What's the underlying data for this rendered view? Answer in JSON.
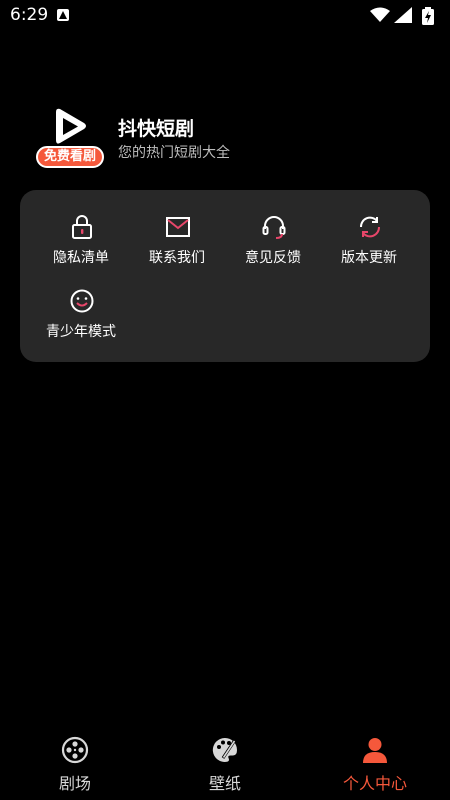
{
  "status_bar": {
    "time": "6:29",
    "icons": [
      "notification-a-icon",
      "wifi-icon",
      "signal-icon",
      "battery-charging-icon"
    ]
  },
  "header": {
    "logo_badge": "免费看剧",
    "title": "抖快短剧",
    "subtitle": "您的热门短剧大全"
  },
  "menu": {
    "items": [
      {
        "label": "隐私清单",
        "icon": "lock-icon"
      },
      {
        "label": "联系我们",
        "icon": "mail-icon"
      },
      {
        "label": "意见反馈",
        "icon": "headset-icon"
      },
      {
        "label": "版本更新",
        "icon": "refresh-icon"
      },
      {
        "label": "青少年模式",
        "icon": "smiley-icon"
      }
    ]
  },
  "bottom_nav": {
    "items": [
      {
        "label": "剧场",
        "icon": "film-reel-icon",
        "active": false
      },
      {
        "label": "壁纸",
        "icon": "palette-icon",
        "active": false
      },
      {
        "label": "个人中心",
        "icon": "user-icon",
        "active": true
      }
    ]
  },
  "colors": {
    "accent": "#f5583b",
    "background": "#000000",
    "card": "#282828",
    "icon_pink": "#e8466a"
  }
}
